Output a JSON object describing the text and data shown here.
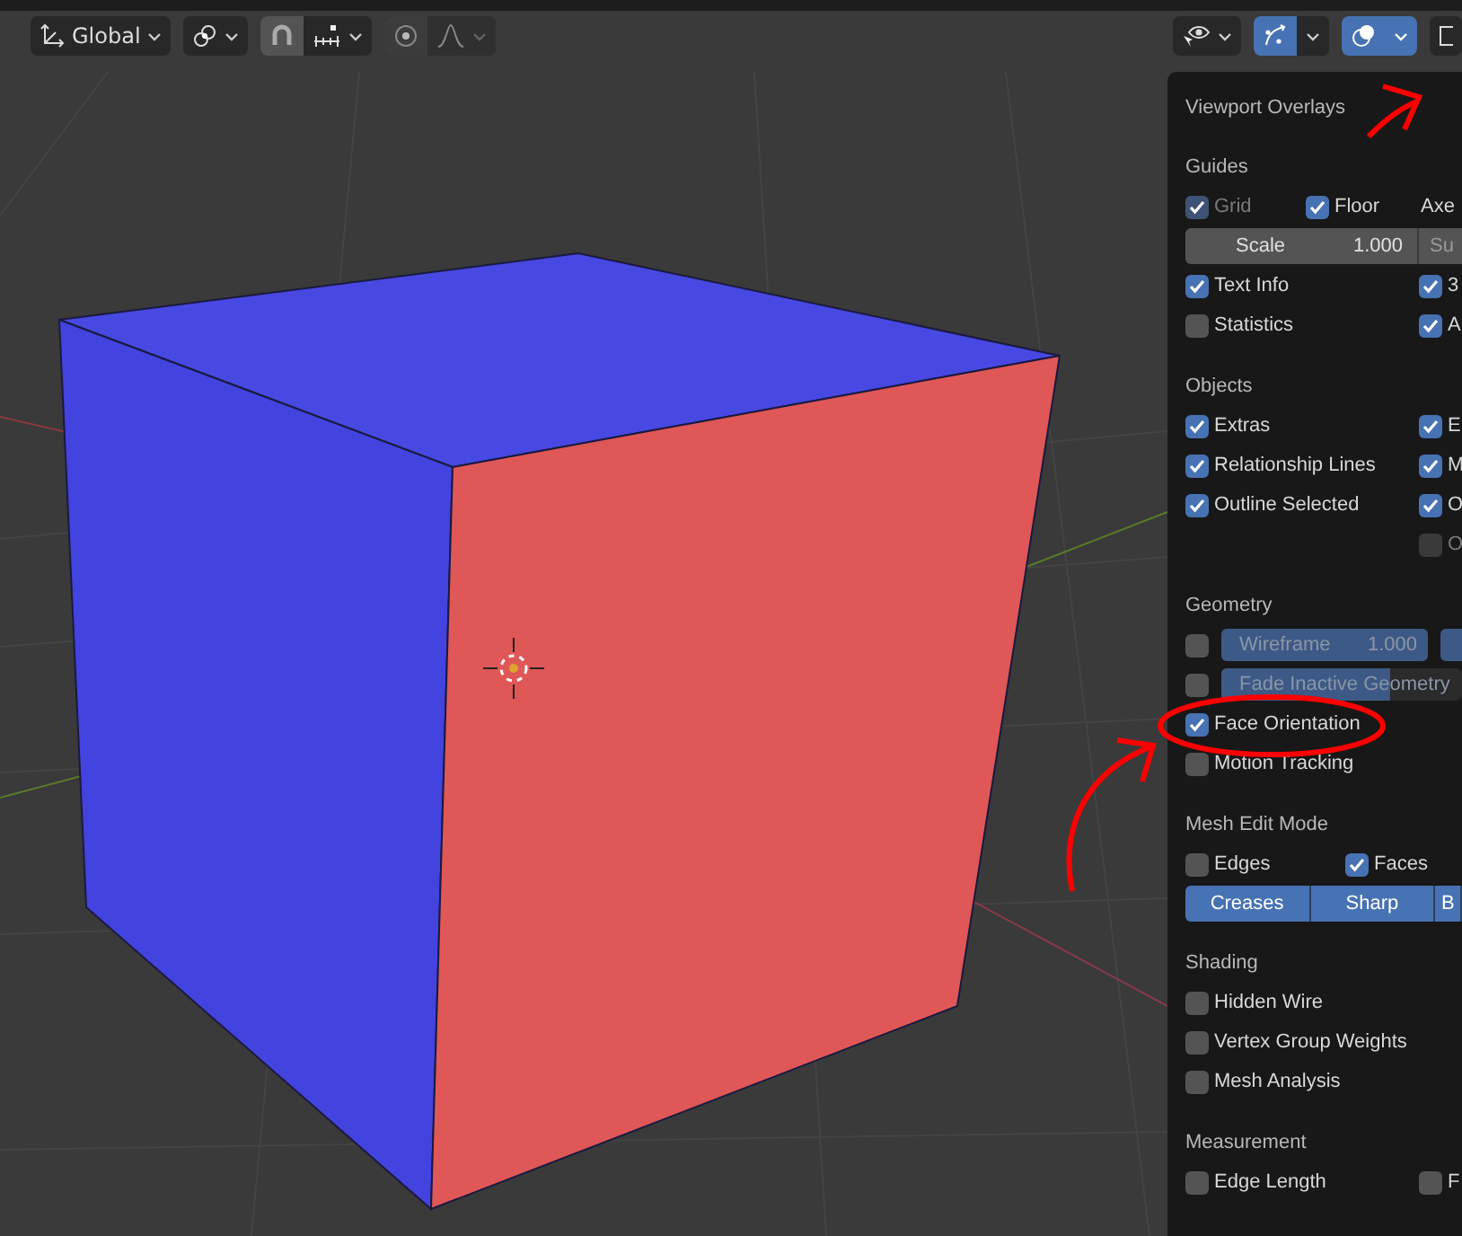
{
  "toolbar": {
    "orientation": {
      "label": "Global"
    },
    "snap": {
      "on": false
    },
    "proportional": {
      "on": false
    },
    "gizmos": {
      "on": true
    },
    "overlays": {
      "on": true,
      "expanded": true
    }
  },
  "overlays_panel": {
    "title": "Viewport Overlays",
    "sections": [
      {
        "title": "Guides",
        "rows": [
          {
            "kind": "triple",
            "items": [
              {
                "kind": "check",
                "label": "Grid",
                "checked": true,
                "disabled": true
              },
              {
                "kind": "check",
                "label": "Floor",
                "checked": true,
                "disabled": false
              },
              {
                "kind": "label",
                "label": "Axe"
              }
            ]
          },
          {
            "kind": "scale",
            "label": "Scale",
            "value": "1.000",
            "next": "Su"
          },
          {
            "kind": "pair",
            "items": [
              {
                "kind": "check",
                "label": "Text Info",
                "checked": true,
                "disabled": false
              },
              {
                "kind": "check",
                "label": "3",
                "checked": true,
                "disabled": false
              }
            ]
          },
          {
            "kind": "pair",
            "items": [
              {
                "kind": "check",
                "label": "Statistics",
                "checked": false,
                "disabled": false
              },
              {
                "kind": "check",
                "label": "A",
                "checked": true,
                "disabled": false
              }
            ]
          }
        ]
      },
      {
        "title": "Objects",
        "rows": [
          {
            "kind": "pair",
            "items": [
              {
                "kind": "check",
                "label": "Extras",
                "checked": true,
                "disabled": false
              },
              {
                "kind": "check",
                "label": "E",
                "checked": true,
                "disabled": false
              }
            ]
          },
          {
            "kind": "pair",
            "items": [
              {
                "kind": "check",
                "label": "Relationship Lines",
                "checked": true,
                "disabled": false
              },
              {
                "kind": "check",
                "label": "M",
                "checked": true,
                "disabled": false
              }
            ]
          },
          {
            "kind": "pair",
            "items": [
              {
                "kind": "check",
                "label": "Outline Selected",
                "checked": true,
                "disabled": false
              },
              {
                "kind": "check",
                "label": "O",
                "checked": true,
                "disabled": false
              }
            ]
          },
          {
            "kind": "pair",
            "items": [
              {
                "kind": "blank"
              },
              {
                "kind": "check",
                "label": "O",
                "checked": false,
                "disabled": true
              }
            ]
          }
        ]
      },
      {
        "title": "Geometry",
        "rows": [
          {
            "kind": "slider",
            "checked": false,
            "label": "Wireframe",
            "value": "1.000",
            "level": 1
          },
          {
            "kind": "slider",
            "checked": false,
            "label": "Fade Inactive Geometry",
            "level": 0.7
          },
          {
            "kind": "pair",
            "items": [
              {
                "kind": "check",
                "label": "Face Orientation",
                "checked": true,
                "disabled": false
              }
            ]
          },
          {
            "kind": "pair",
            "items": [
              {
                "kind": "check",
                "label": "Motion Tracking",
                "checked": false,
                "disabled": false
              }
            ]
          }
        ]
      },
      {
        "title": "Mesh Edit Mode",
        "rows": [
          {
            "kind": "narrow",
            "items": [
              {
                "kind": "check",
                "label": "Edges",
                "checked": false,
                "disabled": false
              },
              {
                "kind": "check",
                "label": "Faces",
                "checked": true,
                "disabled": false
              }
            ]
          },
          {
            "kind": "toggles",
            "items": [
              {
                "label": "Creases",
                "selected": true
              },
              {
                "label": "Sharp",
                "selected": true
              },
              {
                "label": "B",
                "selected": true
              }
            ]
          }
        ]
      },
      {
        "title": "Shading",
        "rows": [
          {
            "kind": "pair",
            "items": [
              {
                "kind": "check",
                "label": "Hidden Wire",
                "checked": false,
                "disabled": false
              }
            ]
          },
          {
            "kind": "pair",
            "items": [
              {
                "kind": "check",
                "label": "Vertex Group Weights",
                "checked": false,
                "disabled": false
              }
            ]
          },
          {
            "kind": "pair",
            "items": [
              {
                "kind": "check",
                "label": "Mesh Analysis",
                "checked": false,
                "disabled": false
              }
            ]
          }
        ]
      },
      {
        "title": "Measurement",
        "rows": [
          {
            "kind": "pair",
            "items": [
              {
                "kind": "check",
                "label": "Edge Length",
                "checked": false,
                "disabled": false
              },
              {
                "kind": "check",
                "label": "F",
                "checked": false,
                "disabled": false
              }
            ]
          }
        ]
      }
    ]
  }
}
